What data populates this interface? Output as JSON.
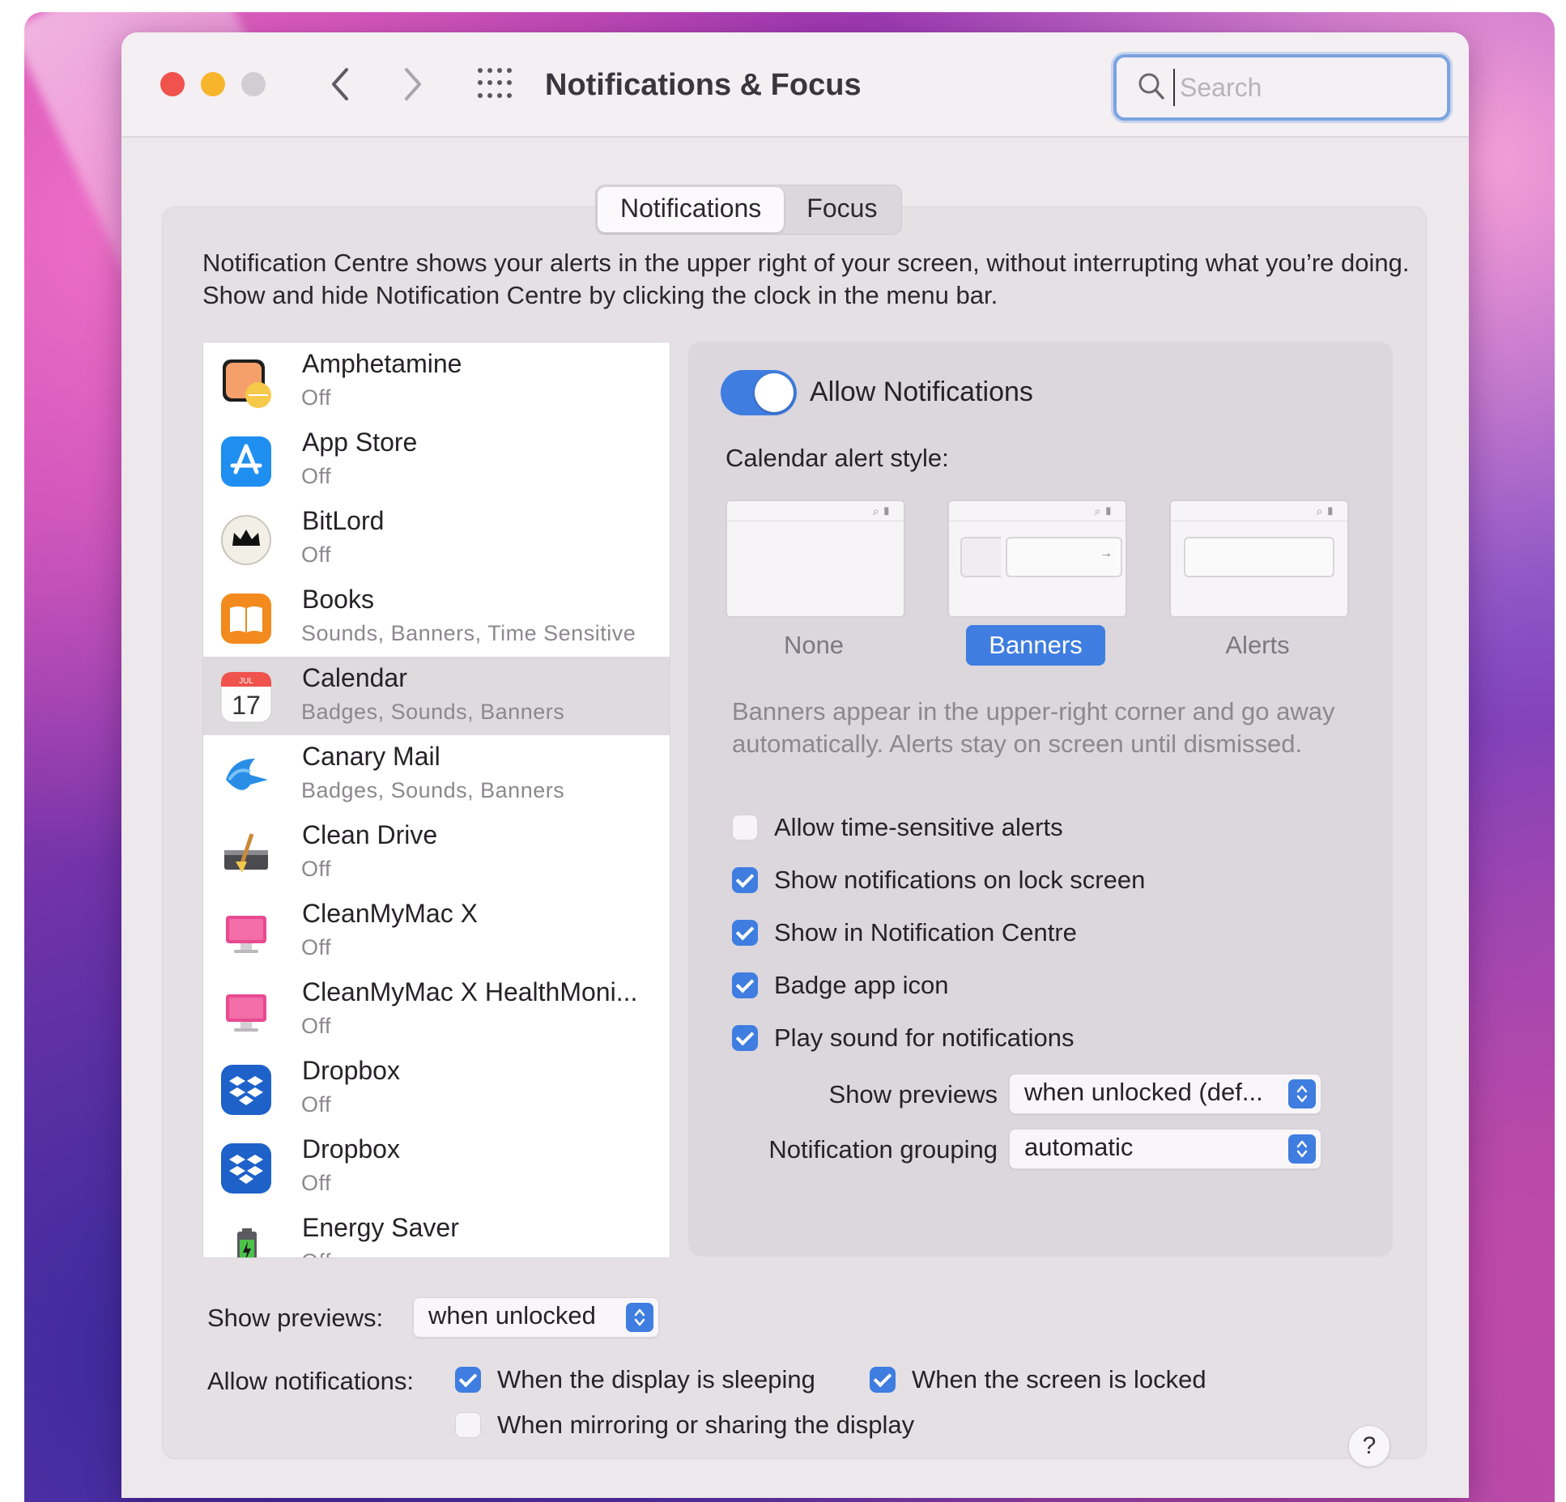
{
  "window": {
    "title": "Notifications & Focus",
    "search_placeholder": "Search"
  },
  "tabs": [
    {
      "label": "Notifications",
      "active": true
    },
    {
      "label": "Focus",
      "active": false
    }
  ],
  "description": "Notification Centre shows your alerts in the upper right of your screen, without interrupting what you’re doing. Show and hide Notification Centre by clicking the clock in the menu bar.",
  "apps": [
    {
      "name": "Amphetamine",
      "status": "Off",
      "icon": "amphetamine-icon"
    },
    {
      "name": "App Store",
      "status": "Off",
      "icon": "app-store-icon"
    },
    {
      "name": "BitLord",
      "status": "Off",
      "icon": "bitlord-icon"
    },
    {
      "name": "Books",
      "status": "Sounds, Banners, Time Sensitive",
      "icon": "books-icon"
    },
    {
      "name": "Calendar",
      "status": "Badges, Sounds, Banners",
      "icon": "calendar-icon",
      "selected": true,
      "icon_month": "JUL",
      "icon_day": "17"
    },
    {
      "name": "Canary Mail",
      "status": "Badges, Sounds, Banners",
      "icon": "canary-mail-icon"
    },
    {
      "name": "Clean Drive",
      "status": "Off",
      "icon": "clean-drive-icon"
    },
    {
      "name": "CleanMyMac X",
      "status": "Off",
      "icon": "cleanmymac-icon"
    },
    {
      "name": "CleanMyMac X HealthMoni...",
      "status": "Off",
      "icon": "cleanmymac-health-icon"
    },
    {
      "name": "Dropbox",
      "status": "Off",
      "icon": "dropbox-icon"
    },
    {
      "name": "Dropbox",
      "status": "Off",
      "icon": "dropbox-icon"
    },
    {
      "name": "Energy Saver",
      "status": "Off",
      "icon": "energy-saver-icon"
    }
  ],
  "detail": {
    "allow_notifications_label": "Allow Notifications",
    "allow_notifications_on": true,
    "alert_style_label": "Calendar alert style:",
    "styles": [
      {
        "label": "None",
        "selected": false
      },
      {
        "label": "Banners",
        "selected": true
      },
      {
        "label": "Alerts",
        "selected": false
      }
    ],
    "style_help": "Banners appear in the upper-right corner and go away automatically. Alerts stay on screen until dismissed.",
    "checkboxes": [
      {
        "label": "Allow time-sensitive alerts",
        "checked": false
      },
      {
        "label": "Show notifications on lock screen",
        "checked": true
      },
      {
        "label": "Show in Notification Centre",
        "checked": true
      },
      {
        "label": "Badge app icon",
        "checked": true
      },
      {
        "label": "Play sound for notifications",
        "checked": true
      }
    ],
    "show_previews_label": "Show previews",
    "show_previews_value": "when unlocked (def...",
    "grouping_label": "Notification grouping",
    "grouping_value": "automatic"
  },
  "global": {
    "show_previews_label": "Show previews:",
    "show_previews_value": "when unlocked",
    "allow_label": "Allow notifications:",
    "options": [
      {
        "label": "When the display is sleeping",
        "checked": true
      },
      {
        "label": "When the screen is locked",
        "checked": true
      },
      {
        "label": "When mirroring or sharing the display",
        "checked": false
      }
    ],
    "help_label": "?"
  },
  "colors": {
    "accent": "#3f7de0",
    "traffic_red": "#f0524c",
    "traffic_yellow": "#f7b52c",
    "traffic_inactive": "#d2cdd2"
  }
}
